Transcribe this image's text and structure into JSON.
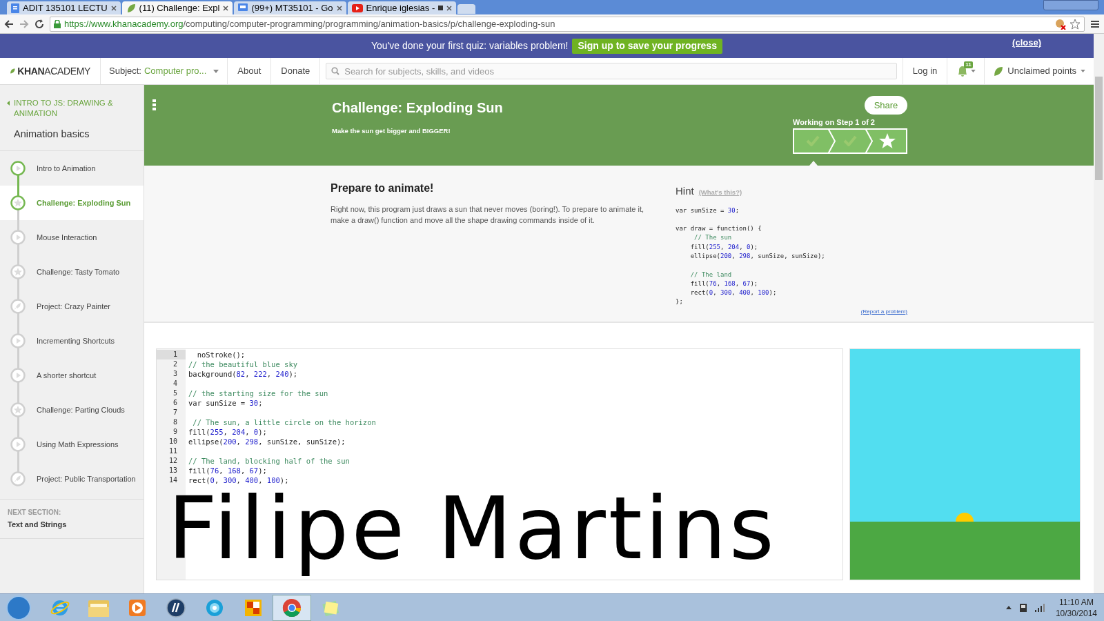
{
  "browser": {
    "tabs": [
      {
        "title": "ADIT 135101 LECTU",
        "kind": "doc",
        "selected": false
      },
      {
        "title": "(11) Challenge: Expl",
        "kind": "leaf",
        "selected": true
      },
      {
        "title": "(99+) MT35101 - Go",
        "kind": "chat",
        "selected": false
      },
      {
        "title": "Enrique iglesias -",
        "kind": "video",
        "selected": false
      }
    ],
    "url_host": "https://www.khanacademy.org",
    "url_path": "/computing/computer-programming/programming/animation-basics/p/challenge-exploding-sun"
  },
  "banner": {
    "message": "You've done your first quiz: variables problem!",
    "button": "Sign up to save your progress",
    "close": "(close)"
  },
  "nav": {
    "logo_bold": "KHAN",
    "logo_light": "ACADEMY",
    "subject_label": "Subject:",
    "subject_value": "Computer pro...",
    "links": [
      "About",
      "Donate"
    ],
    "search_placeholder": "Search for subjects, skills, and videos",
    "login": "Log in",
    "notification_count": "11",
    "points": "Unclaimed points"
  },
  "sidebar": {
    "breadcrumb": "INTRO TO JS: DRAWING & ANIMATION",
    "title": "Animation basics",
    "items": [
      {
        "label": "Intro to Animation",
        "kind": "video",
        "done": true,
        "selected": false
      },
      {
        "label": "Challenge: Exploding Sun",
        "kind": "challenge",
        "done": true,
        "selected": true
      },
      {
        "label": "Mouse Interaction",
        "kind": "video",
        "done": false,
        "selected": false
      },
      {
        "label": "Challenge: Tasty Tomato",
        "kind": "challenge",
        "done": false,
        "selected": false
      },
      {
        "label": "Project: Crazy Painter",
        "kind": "project",
        "done": false,
        "selected": false
      },
      {
        "label": "Incrementing Shortcuts",
        "kind": "video",
        "done": false,
        "selected": false
      },
      {
        "label": "A shorter shortcut",
        "kind": "video",
        "done": false,
        "selected": false
      },
      {
        "label": "Challenge: Parting Clouds",
        "kind": "challenge",
        "done": false,
        "selected": false
      },
      {
        "label": "Using Math Expressions",
        "kind": "video",
        "done": false,
        "selected": false
      },
      {
        "label": "Project: Public Transportation",
        "kind": "project",
        "done": false,
        "selected": false
      }
    ],
    "next_label": "NEXT SECTION:",
    "next_title": "Text and Strings"
  },
  "header": {
    "title": "Challenge: Exploding Sun",
    "subtitle": "Make the sun get bigger and BIGGER!",
    "share": "Share",
    "step_text": "Working on Step 1 of 2",
    "steps": [
      {
        "kind": "check",
        "done": false
      },
      {
        "kind": "check",
        "done": false
      },
      {
        "kind": "star",
        "done": false
      }
    ]
  },
  "step": {
    "title": "Prepare to animate!",
    "body": "Right now, this program just draws a sun that never moves (boring!). To prepare to animate it, make a draw() function and move all the shape drawing commands inside of it.",
    "hint_title": "Hint",
    "hint_link": "(What's this?)",
    "report": "(Report a problem)",
    "hint_code": "var sunSize = 30;\n\nvar draw = function() {\n     // The sun\n    fill(255, 204, 0);\n    ellipse(200, 298, sunSize, sunSize);\n\n    // The land\n    fill(76, 168, 67);\n    rect(0, 300, 400, 100);\n};"
  },
  "editor": {
    "line_numbers": [
      "1",
      "2",
      "3",
      "4",
      "5",
      "6",
      "7",
      "8",
      "9",
      "10",
      "11",
      "12",
      "13",
      "14"
    ],
    "code": "  noStroke();\n// the beautiful blue sky\nbackground(82, 222, 240);\n\n// the starting size for the sun\nvar sunSize = 30;\n\n // The sun, a little circle on the horizon\nfill(255, 204, 0);\nellipse(200, 298, sunSize, sunSize);\n\n// The land, blocking half of the sun\nfill(76, 168, 67);\nrect(0, 300, 400, 100);"
  },
  "overlay_text": "Filipe Martins",
  "taskbar": {
    "apps": [
      {
        "kind": "ie",
        "selected": false
      },
      {
        "kind": "folder",
        "selected": false
      },
      {
        "kind": "media",
        "selected": false
      },
      {
        "kind": "hp",
        "selected": false
      },
      {
        "kind": "globe",
        "selected": false
      },
      {
        "kind": "office",
        "selected": false
      },
      {
        "kind": "chrome",
        "selected": true
      },
      {
        "kind": "notes",
        "selected": false
      }
    ],
    "time": "11:10 AM",
    "date": "10/30/2014"
  }
}
